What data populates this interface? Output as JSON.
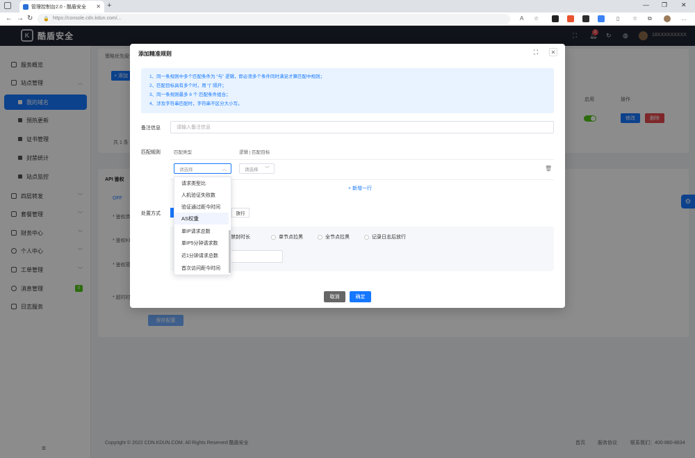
{
  "browser": {
    "tab_title": "管理控制台2.0 - 酷盾安全",
    "url": "https://console.cdn.kdun.com/..."
  },
  "header": {
    "brand": "酷盾安全",
    "notification_count": "0",
    "username": "18XXXXXXXXX"
  },
  "sidebar": {
    "items": [
      {
        "label": "服务概览"
      },
      {
        "label": "站点管理"
      },
      {
        "label": "我的域名"
      },
      {
        "label": "预热更新"
      },
      {
        "label": "证书管理"
      },
      {
        "label": "封禁统计"
      },
      {
        "label": "站点监控"
      },
      {
        "label": "四层转发"
      },
      {
        "label": "套餐管理"
      },
      {
        "label": "财务中心"
      },
      {
        "label": "个人中心"
      },
      {
        "label": "工单管理"
      },
      {
        "label": "消息管理"
      },
      {
        "label": "日志服务"
      }
    ],
    "message_badge": "0"
  },
  "background": {
    "strategy_hint": "策略优先级说明",
    "add_btn": "+ 添加",
    "col_enabled": "启用",
    "col_action": "操作",
    "edit_btn": "修改",
    "delete_btn": "删除",
    "total": "共 1 条",
    "api_section": "API 鉴权",
    "off": "OFF",
    "save_btn": "保存配置",
    "field_1": "* 鉴权类型",
    "field_2": "* 鉴权KEY",
    "field_3": "* 鉴权密钥",
    "field_4": "* 超时时间"
  },
  "footer": {
    "copyright": "Copyright © 2022 CDN.KDUN.COM. All Rights Reserved 酷盾安全",
    "home": "首页",
    "agreement": "服务协议",
    "contact": "联系我们：400-880-8834"
  },
  "modal": {
    "title": "添加精准规则",
    "tips": [
      "1、同一条规则中多个匹配条件为 “与” 逻辑，即必须多个条件同时满足才算匹配中规则；",
      "2、匹配目标具有多个时，用 “|” 隔开；",
      "3、同一条规则最多 6 个 匹配条件组合；",
      "4、涉及字符串匹配时，字符串不区分大小写。"
    ],
    "remark_label": "备注信息",
    "remark_placeholder": "请输入备注信息",
    "match_label": "匹配规则",
    "col_type": "匹配类型",
    "col_logic": "逻辑 | 匹配目标",
    "type_placeholder": "请选择",
    "logic_placeholder": "请选择",
    "add_row": "+ 新增一行",
    "action_label": "处置方式",
    "action_release": "放行",
    "radios": [
      "禁封时长",
      "单节点拉黑",
      "全节点拉黑",
      "记录日志后放行"
    ],
    "cancel": "取消",
    "confirm": "确定"
  },
  "dropdown": {
    "options": [
      "请求类型比",
      "人机验证失败数",
      "验证通过距今时间",
      "AS权重",
      "单IP请求总数",
      "单IP5分钟请求数",
      "近1分钟请求总数",
      "首次访问距今时间"
    ],
    "hovered_index": 3
  }
}
